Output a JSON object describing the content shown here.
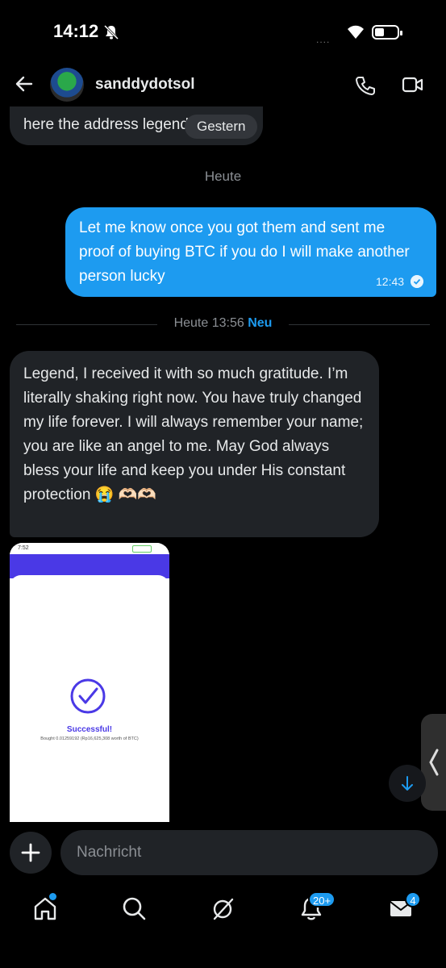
{
  "status_bar": {
    "time": "14:12",
    "signal_dots": "....",
    "icons": [
      "bell-off-icon",
      "wifi-icon",
      "battery-icon"
    ]
  },
  "header": {
    "username": "sanddydotsol",
    "icons": [
      "back-arrow-icon",
      "phone-icon",
      "video-icon"
    ]
  },
  "messages": {
    "msg1": {
      "text": "here the address legend",
      "day_pill": "Gestern"
    },
    "day_label": "Heute",
    "outgoing": {
      "text": "Let me know once you got them and sent me proof of buying BTC if you do I will make another person lucky",
      "time": "12:43"
    },
    "separator": {
      "label": "Heute 13:56",
      "new_label": "Neu"
    },
    "incoming": {
      "text": "Legend, I received it with so much gratitude. I’m literally shaking right now. You have truly changed my life forever. I will always remember your name; you are like an angel to me. May God always bless your life and keep you under His constant protection 😭 🫶🏻🫶🏻"
    },
    "image": {
      "status_time": "7:52",
      "title": "Successful!",
      "subtitle": "Bought 0.01259192 (Rp16,625,308 worth of BTC)"
    }
  },
  "composer": {
    "placeholder": "Nachricht"
  },
  "nav": {
    "items": [
      "home",
      "search",
      "grok",
      "notifications",
      "messages"
    ],
    "notifications_badge": "20+",
    "messages_badge": "4"
  },
  "colors": {
    "accent": "#1d9bf0",
    "bubble_in": "#202327",
    "brand_purple": "#4a39e6"
  }
}
